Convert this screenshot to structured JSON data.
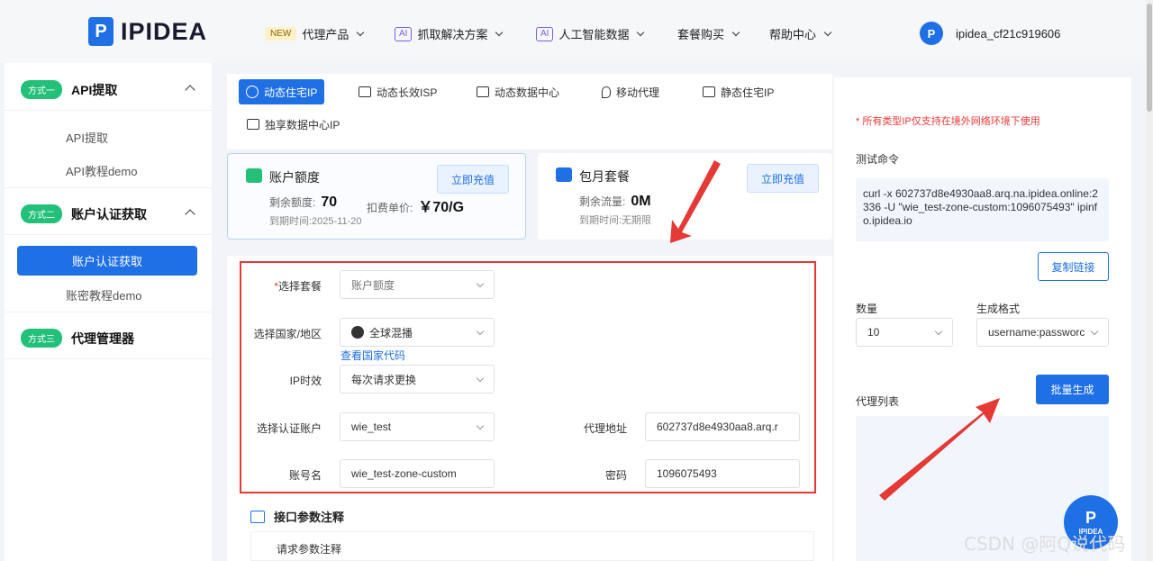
{
  "header": {
    "brand": "IPIDEA",
    "logo_letter": "P",
    "nav": [
      {
        "badge": "NEW",
        "label": "代理产品"
      },
      {
        "badge": "AI",
        "label": "抓取解决方案"
      },
      {
        "badge": "AI",
        "label": "人工智能数据"
      },
      {
        "badge": "",
        "label": "套餐购买"
      },
      {
        "badge": "",
        "label": "帮助中心"
      }
    ],
    "username": "ipidea_cf21c919606"
  },
  "sidebar": {
    "sections": [
      {
        "pill": "方式一",
        "title": "API提取",
        "items": [
          "API提取",
          "API教程demo"
        ]
      },
      {
        "pill": "方式二",
        "title": "账户认证获取",
        "items": [
          "账户认证获取",
          "账密教程demo"
        ]
      },
      {
        "pill": "方式三",
        "title": "代理管理器",
        "items": []
      }
    ],
    "active_item": "账户认证获取"
  },
  "tabs": [
    "动态住宅IP",
    "动态长效ISP",
    "动态数据中心",
    "移动代理",
    "静态住宅IP",
    "独享数据中心IP"
  ],
  "active_tab": "动态住宅IP",
  "cards": [
    {
      "title": "账户额度",
      "button": "立即充值",
      "remaining_label": "剩余额度:",
      "remaining_value": "70",
      "price_label": "扣费单价:",
      "price_value": "￥70/G",
      "expiry": "到期时间:2025-11-20",
      "icon_color": "#23c07a"
    },
    {
      "title": "包月套餐",
      "button": "立即充值",
      "remaining_label": "剩余流量:",
      "remaining_value": "0M",
      "expiry": "到期时间:无期限",
      "icon_color": "#1f6fe5"
    }
  ],
  "form": {
    "plan_label": "选择套餐",
    "plan_value": "账户额度",
    "region_label": "选择国家/地区",
    "region_value": "全球混播",
    "region_link": "查看国家代码",
    "ip_label": "IP时效",
    "ip_value": "每次请求更换",
    "account_label": "选择认证账户",
    "account_value": "wie_test",
    "proxy_label": "代理地址",
    "proxy_value": "602737d8e4930aa8.arq.r",
    "username_label": "账号名",
    "username_value": "wie_test-zone-custom",
    "password_label": "密码",
    "password_value": "1096075493"
  },
  "params": {
    "title": "接口参数注释",
    "row": "请求参数注释"
  },
  "right_panel": {
    "note": "* 所有类型IP仅支持在境外网络环境下使用",
    "cmd_label": "测试命令",
    "cmd": "curl -x 602737d8e4930aa8.arq.na.ipidea.online:2336 -U \"wie_test-zone-custom:1096075493\" ipinfo.ipidea.io",
    "copy_button": "复制链接",
    "qty_label": "数量",
    "qty_value": "10",
    "format_label": "生成格式",
    "format_value": "username:passworc",
    "generate_button": "批量生成",
    "list_label": "代理列表"
  },
  "float_logo": {
    "letter": "P",
    "text": "IPIDEA"
  },
  "watermark": "CSDN @阿Q说代码",
  "colors": {
    "primary": "#1f6fe5",
    "green": "#23c07a",
    "red": "#e53935"
  }
}
